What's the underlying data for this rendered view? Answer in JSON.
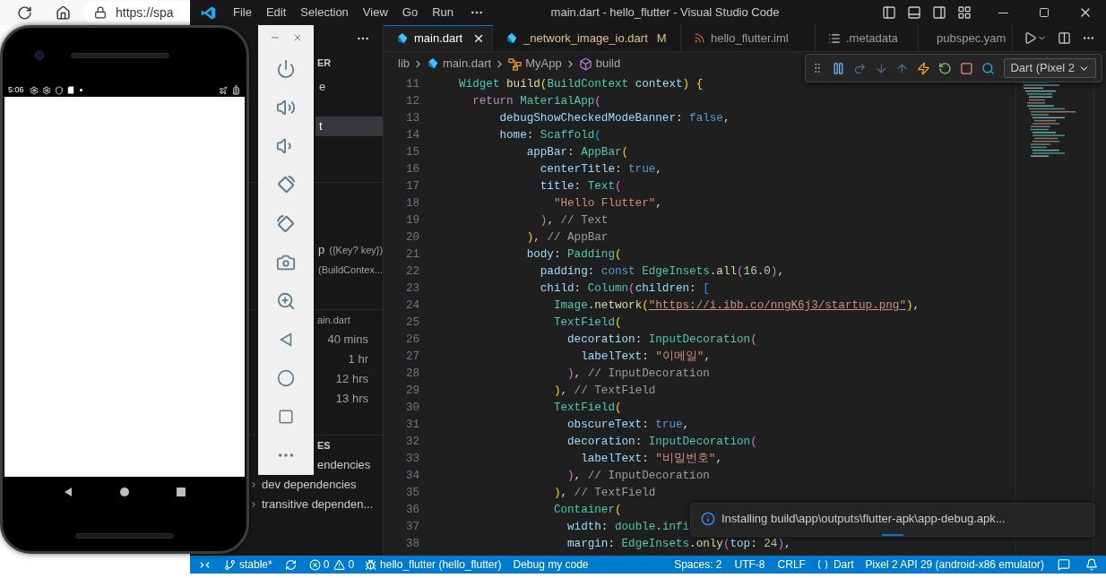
{
  "browser": {
    "address": "https://spa"
  },
  "window": {
    "title": "main.dart - hello_flutter - Visual Studio Code",
    "menu": [
      "File",
      "Edit",
      "Selection",
      "View",
      "Go",
      "Run"
    ]
  },
  "tabs": [
    {
      "label": "main.dart",
      "kind": "dart",
      "selected": true,
      "modified": false
    },
    {
      "label": "_network_image_io.dart",
      "kind": "dart",
      "selected": false,
      "modified": true,
      "badge": "M"
    },
    {
      "label": "hello_flutter.iml",
      "kind": "xml",
      "selected": false,
      "modified": false
    },
    {
      "label": ".metadata",
      "kind": "text",
      "selected": false,
      "modified": false
    },
    {
      "label": "pubspec.yam",
      "kind": "yaml",
      "selected": false,
      "modified": false
    }
  ],
  "breadcrumb": [
    {
      "label": "lib",
      "kind": "folder"
    },
    {
      "label": "main.dart",
      "kind": "dart"
    },
    {
      "label": "MyApp",
      "kind": "class"
    },
    {
      "label": "build",
      "kind": "method"
    }
  ],
  "debug_toolbar": {
    "device": "Dart (Pixel 2"
  },
  "sidebar": {
    "header": "ER",
    "folders": [
      {
        "text": "e",
        "selected": false
      },
      {
        "text": "t",
        "selected": true
      }
    ],
    "outline": [
      {
        "text": "p",
        "detail": "({Key? key})"
      },
      {
        "detail": "(BuildContex..."
      }
    ],
    "timeline": {
      "title": "ain.dart",
      "entries": [
        "40 mins",
        "1 hr",
        "12 hrs",
        "13 hrs"
      ]
    },
    "dependencies": {
      "title": "ES",
      "items": [
        {
          "text": "endencies",
          "kind": "fragment"
        },
        {
          "text": "dev dependencies",
          "kind": "node"
        },
        {
          "text": "transitive dependen...",
          "kind": "node"
        }
      ]
    }
  },
  "editor": {
    "lines": [
      {
        "number": "11",
        "tokens": [
          {
            "text": "  Widget",
            "kind": "type"
          },
          {
            "text": " build",
            "kind": "fn"
          },
          {
            "text": "(",
            "kind": "b1"
          },
          {
            "text": "BuildContext",
            "kind": "type"
          },
          {
            "text": " context",
            "kind": "prop"
          },
          {
            "text": ")",
            "kind": "b1"
          },
          {
            "text": " {",
            "kind": "b1"
          }
        ]
      },
      {
        "number": "12",
        "tokens": [
          {
            "text": "    return",
            "kind": "kw"
          },
          {
            "text": " MaterialApp",
            "kind": "type"
          },
          {
            "text": "(",
            "kind": "b2"
          }
        ]
      },
      {
        "number": "13",
        "tokens": [
          {
            "text": "        debugShowCheckedModeBanner",
            "kind": "prop"
          },
          {
            "text": ": ",
            "kind": "p"
          },
          {
            "text": "false",
            "kind": "const"
          },
          {
            "text": ",",
            "kind": "p"
          }
        ]
      },
      {
        "number": "14",
        "tokens": [
          {
            "text": "        home",
            "kind": "prop"
          },
          {
            "text": ": ",
            "kind": "p"
          },
          {
            "text": "Scaffold",
            "kind": "type"
          },
          {
            "text": "(",
            "kind": "b3"
          }
        ]
      },
      {
        "number": "15",
        "tokens": [
          {
            "text": "            appBar",
            "kind": "prop"
          },
          {
            "text": ": ",
            "kind": "p"
          },
          {
            "text": "AppBar",
            "kind": "type"
          },
          {
            "text": "(",
            "kind": "b1"
          }
        ]
      },
      {
        "number": "16",
        "tokens": [
          {
            "text": "              centerTitle",
            "kind": "prop"
          },
          {
            "text": ": ",
            "kind": "p"
          },
          {
            "text": "true",
            "kind": "const"
          },
          {
            "text": ",",
            "kind": "p"
          }
        ]
      },
      {
        "number": "17",
        "tokens": [
          {
            "text": "              title",
            "kind": "prop"
          },
          {
            "text": ": ",
            "kind": "p"
          },
          {
            "text": "Text",
            "kind": "type"
          },
          {
            "text": "(",
            "kind": "b2"
          }
        ]
      },
      {
        "number": "18",
        "tokens": [
          {
            "text": "                \"Hello Flutter\"",
            "kind": "str"
          },
          {
            "text": ",",
            "kind": "p"
          }
        ]
      },
      {
        "number": "19",
        "tokens": [
          {
            "text": "              )",
            "kind": "b2"
          },
          {
            "text": ", ",
            "kind": "p"
          },
          {
            "text": "// Text",
            "kind": "cmt"
          }
        ]
      },
      {
        "number": "20",
        "tokens": [
          {
            "text": "            )",
            "kind": "b1"
          },
          {
            "text": ", ",
            "kind": "p"
          },
          {
            "text": "// AppBar",
            "kind": "cmt"
          }
        ]
      },
      {
        "number": "21",
        "tokens": [
          {
            "text": "            body",
            "kind": "prop"
          },
          {
            "text": ": ",
            "kind": "p"
          },
          {
            "text": "Padding",
            "kind": "type"
          },
          {
            "text": "(",
            "kind": "b1"
          }
        ]
      },
      {
        "number": "22",
        "tokens": [
          {
            "text": "              padding",
            "kind": "prop"
          },
          {
            "text": ": ",
            "kind": "p"
          },
          {
            "text": "const",
            "kind": "const"
          },
          {
            "text": " EdgeInsets",
            "kind": "type"
          },
          {
            "text": ".",
            "kind": "p"
          },
          {
            "text": "all",
            "kind": "fn"
          },
          {
            "text": "(",
            "kind": "b2"
          },
          {
            "text": "16.0",
            "kind": "num"
          },
          {
            "text": ")",
            "kind": "b2"
          },
          {
            "text": ",",
            "kind": "p"
          }
        ]
      },
      {
        "number": "23",
        "tokens": [
          {
            "text": "              child",
            "kind": "prop"
          },
          {
            "text": ": ",
            "kind": "p"
          },
          {
            "text": "Column",
            "kind": "type"
          },
          {
            "text": "(",
            "kind": "b2"
          },
          {
            "text": "children",
            "kind": "prop"
          },
          {
            "text": ": ",
            "kind": "p"
          },
          {
            "text": "[",
            "kind": "b3"
          }
        ]
      },
      {
        "number": "24",
        "tokens": [
          {
            "text": "                Image",
            "kind": "type"
          },
          {
            "text": ".",
            "kind": "p"
          },
          {
            "text": "network",
            "kind": "fn"
          },
          {
            "text": "(",
            "kind": "b1"
          },
          {
            "text": "\"https://i.ibb.co/nngK6j3/startup.png\"",
            "kind": "url"
          },
          {
            "text": ")",
            "kind": "b1"
          },
          {
            "text": ",",
            "kind": "p"
          }
        ]
      },
      {
        "number": "25",
        "tokens": [
          {
            "text": "                TextField",
            "kind": "type"
          },
          {
            "text": "(",
            "kind": "b1"
          }
        ]
      },
      {
        "number": "26",
        "tokens": [
          {
            "text": "                  decoration",
            "kind": "prop"
          },
          {
            "text": ": ",
            "kind": "p"
          },
          {
            "text": "InputDecoration",
            "kind": "type"
          },
          {
            "text": "(",
            "kind": "b2"
          }
        ]
      },
      {
        "number": "27",
        "tokens": [
          {
            "text": "                    labelText",
            "kind": "prop"
          },
          {
            "text": ": ",
            "kind": "p"
          },
          {
            "text": "\"이메일\"",
            "kind": "str"
          },
          {
            "text": ",",
            "kind": "p"
          }
        ]
      },
      {
        "number": "28",
        "tokens": [
          {
            "text": "                  )",
            "kind": "b2"
          },
          {
            "text": ", ",
            "kind": "p"
          },
          {
            "text": "// InputDecoration",
            "kind": "cmt"
          }
        ]
      },
      {
        "number": "29",
        "tokens": [
          {
            "text": "                )",
            "kind": "b1"
          },
          {
            "text": ", ",
            "kind": "p"
          },
          {
            "text": "// TextField",
            "kind": "cmt"
          }
        ]
      },
      {
        "number": "30",
        "tokens": [
          {
            "text": "                TextField",
            "kind": "type"
          },
          {
            "text": "(",
            "kind": "b1"
          }
        ]
      },
      {
        "number": "31",
        "tokens": [
          {
            "text": "                  obscureText",
            "kind": "prop"
          },
          {
            "text": ": ",
            "kind": "p"
          },
          {
            "text": "true",
            "kind": "const"
          },
          {
            "text": ",",
            "kind": "p"
          }
        ]
      },
      {
        "number": "32",
        "tokens": [
          {
            "text": "                  decoration",
            "kind": "prop"
          },
          {
            "text": ": ",
            "kind": "p"
          },
          {
            "text": "InputDecoration",
            "kind": "type"
          },
          {
            "text": "(",
            "kind": "b2"
          }
        ]
      },
      {
        "number": "33",
        "tokens": [
          {
            "text": "                    labelText",
            "kind": "prop"
          },
          {
            "text": ": ",
            "kind": "p"
          },
          {
            "text": "\"비밀번호\"",
            "kind": "str"
          },
          {
            "text": ",",
            "kind": "p"
          }
        ]
      },
      {
        "number": "34",
        "tokens": [
          {
            "text": "                  )",
            "kind": "b2"
          },
          {
            "text": ", ",
            "kind": "p"
          },
          {
            "text": "// InputDecoration",
            "kind": "cmt"
          }
        ]
      },
      {
        "number": "35",
        "tokens": [
          {
            "text": "                )",
            "kind": "b1"
          },
          {
            "text": ", ",
            "kind": "p"
          },
          {
            "text": "// TextField",
            "kind": "cmt"
          }
        ]
      },
      {
        "number": "36",
        "tokens": [
          {
            "text": "                Container",
            "kind": "type"
          },
          {
            "text": "(",
            "kind": "b1"
          }
        ]
      },
      {
        "number": "37",
        "tokens": [
          {
            "text": "                  width",
            "kind": "prop"
          },
          {
            "text": ": ",
            "kind": "p"
          },
          {
            "text": "double",
            "kind": "type"
          },
          {
            "text": ".",
            "kind": "p"
          },
          {
            "text": "infi",
            "kind": "type"
          }
        ]
      },
      {
        "number": "38",
        "tokens": [
          {
            "text": "                  margin",
            "kind": "prop"
          },
          {
            "text": ": ",
            "kind": "p"
          },
          {
            "text": "EdgeInsets",
            "kind": "type"
          },
          {
            "text": ".",
            "kind": "p"
          },
          {
            "text": "only",
            "kind": "fn"
          },
          {
            "text": "(",
            "kind": "b2"
          },
          {
            "text": "top",
            "kind": "prop"
          },
          {
            "text": ": ",
            "kind": "p"
          },
          {
            "text": "24",
            "kind": "num"
          },
          {
            "text": ")",
            "kind": "b2"
          },
          {
            "text": ",",
            "kind": "p"
          }
        ]
      }
    ]
  },
  "notification": {
    "message": "Installing build\\app\\outputs\\flutter-apk\\app-debug.apk..."
  },
  "status_bar": {
    "left": [
      {
        "kind": "remote"
      },
      {
        "kind": "branch",
        "text": "stable*"
      },
      {
        "kind": "sync"
      },
      {
        "kind": "problems",
        "errors": "0",
        "warnings": "0"
      },
      {
        "kind": "debug",
        "text": "hello_flutter (hello_flutter)"
      },
      {
        "kind": "text",
        "text": "Debug my code"
      }
    ],
    "right": [
      {
        "kind": "text",
        "text": "Spaces: 2"
      },
      {
        "kind": "text",
        "text": "UTF-8"
      },
      {
        "kind": "text",
        "text": "CRLF"
      },
      {
        "kind": "language",
        "text": "Dart"
      },
      {
        "kind": "text",
        "text": "Pixel 2 API 29 (android-x86 emulator)"
      },
      {
        "kind": "feedback"
      },
      {
        "kind": "bell"
      }
    ]
  },
  "phone": {
    "time": "5:06"
  }
}
